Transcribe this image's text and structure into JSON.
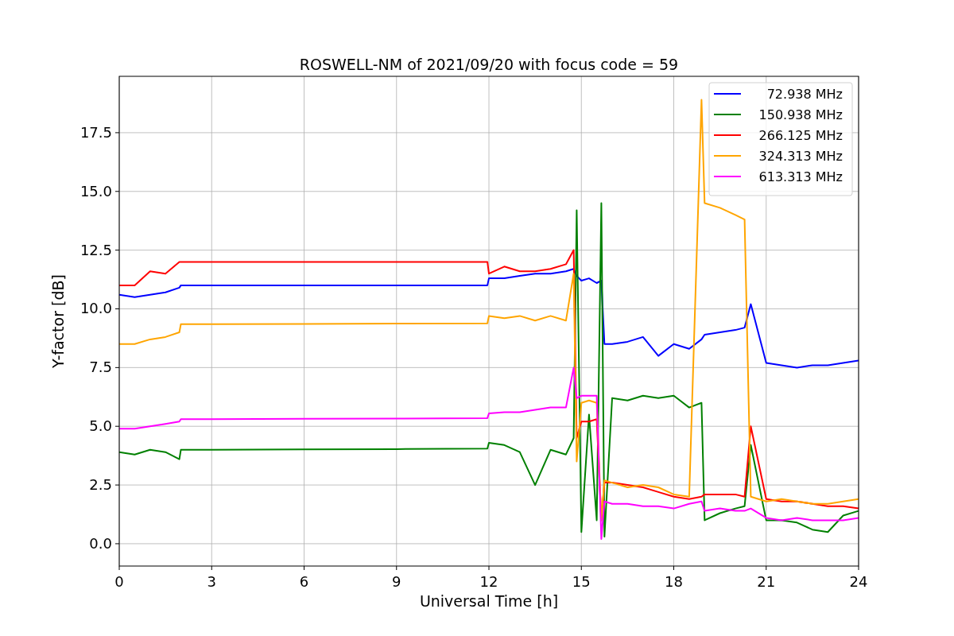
{
  "figure": {
    "chart_data": {
      "type": "line",
      "title": "ROSWELL-NM of 2021/09/20 with focus code = 59",
      "xlabel": "Universal Time [h]",
      "ylabel": "Y-factor [dB]",
      "x": [
        0,
        0.5,
        1,
        1.5,
        1.95,
        2,
        3,
        6,
        9,
        11.95,
        12,
        12.5,
        13,
        13.5,
        14,
        14.5,
        14.75,
        14.85,
        15,
        15.25,
        15.5,
        15.65,
        15.75,
        16,
        16.5,
        17,
        17.5,
        18,
        18.5,
        18.9,
        19,
        19.5,
        20,
        20.3,
        20.5,
        21,
        21.5,
        22,
        22.5,
        23,
        23.5,
        24
      ],
      "series": [
        {
          "name": "72.938 MHz",
          "color": "#0000ff",
          "values": [
            10.6,
            10.5,
            10.6,
            10.7,
            10.9,
            11.0,
            11.0,
            11.0,
            11.0,
            11.0,
            11.3,
            11.3,
            11.4,
            11.5,
            11.5,
            11.6,
            11.7,
            11.4,
            11.2,
            11.3,
            11.1,
            11.2,
            8.5,
            8.5,
            8.6,
            8.8,
            8.0,
            8.5,
            8.3,
            8.7,
            8.9,
            9.0,
            9.1,
            9.2,
            10.2,
            7.7,
            7.6,
            7.5,
            7.6,
            7.6,
            7.7,
            7.8
          ]
        },
        {
          "name": "150.938 MHz",
          "color": "#008000",
          "values": [
            3.9,
            3.8,
            4.0,
            3.9,
            3.6,
            4.0,
            4.0,
            4.02,
            4.03,
            4.05,
            4.3,
            4.2,
            3.9,
            2.5,
            4.0,
            3.8,
            4.5,
            14.2,
            0.5,
            5.5,
            1.0,
            14.5,
            0.3,
            6.2,
            6.1,
            6.3,
            6.2,
            6.3,
            5.8,
            6.0,
            1.0,
            1.3,
            1.5,
            1.6,
            4.2,
            1.0,
            1.0,
            0.9,
            0.6,
            0.5,
            1.2,
            1.4
          ]
        },
        {
          "name": "266.125 MHz",
          "color": "#ff0000",
          "values": [
            11.0,
            11.0,
            11.6,
            11.5,
            12.0,
            12.0,
            12.0,
            12.0,
            12.0,
            12.0,
            11.5,
            11.8,
            11.6,
            11.6,
            11.7,
            11.9,
            12.5,
            4.5,
            5.2,
            5.2,
            5.3,
            1.0,
            2.6,
            2.6,
            2.5,
            2.4,
            2.2,
            2.0,
            1.9,
            2.0,
            2.1,
            2.1,
            2.1,
            2.0,
            5.0,
            1.9,
            1.8,
            1.8,
            1.7,
            1.6,
            1.6,
            1.5
          ]
        },
        {
          "name": "324.313 MHz",
          "color": "#ffa500",
          "values": [
            8.5,
            8.5,
            8.7,
            8.8,
            9.0,
            9.35,
            9.35,
            9.36,
            9.37,
            9.38,
            9.7,
            9.6,
            9.7,
            9.5,
            9.7,
            9.5,
            11.5,
            3.5,
            6.0,
            6.1,
            6.0,
            1.0,
            2.7,
            2.6,
            2.4,
            2.5,
            2.4,
            2.1,
            2.0,
            18.9,
            14.5,
            14.3,
            14.0,
            13.8,
            2.0,
            1.8,
            1.9,
            1.8,
            1.7,
            1.7,
            1.8,
            1.9
          ]
        },
        {
          "name": "613.313 MHz",
          "color": "#ff00ff",
          "values": [
            4.9,
            4.9,
            5.0,
            5.1,
            5.2,
            5.3,
            5.3,
            5.32,
            5.33,
            5.35,
            5.55,
            5.6,
            5.6,
            5.7,
            5.8,
            5.8,
            7.5,
            6.2,
            6.3,
            6.3,
            6.3,
            0.2,
            1.8,
            1.7,
            1.7,
            1.6,
            1.6,
            1.5,
            1.7,
            1.8,
            1.4,
            1.5,
            1.4,
            1.4,
            1.5,
            1.1,
            1.0,
            1.1,
            1.0,
            1.0,
            1.0,
            1.1
          ]
        }
      ],
      "grid": true,
      "legend": "upper right",
      "xlim": [
        0,
        24
      ],
      "ylim": [
        -0.95,
        19.9
      ],
      "xticks": [
        0,
        3,
        6,
        9,
        12,
        15,
        18,
        21,
        24
      ],
      "yticks": [
        {
          "value": 0,
          "label": "0.0"
        },
        {
          "value": 2.5,
          "label": "2.5"
        },
        {
          "value": 5,
          "label": "5.0"
        },
        {
          "value": 7.5,
          "label": "7.5"
        },
        {
          "value": 10,
          "label": "10.0"
        },
        {
          "value": 12.5,
          "label": "12.5"
        },
        {
          "value": 15,
          "label": "15.0"
        },
        {
          "value": 17.5,
          "label": "17.5"
        }
      ]
    }
  }
}
